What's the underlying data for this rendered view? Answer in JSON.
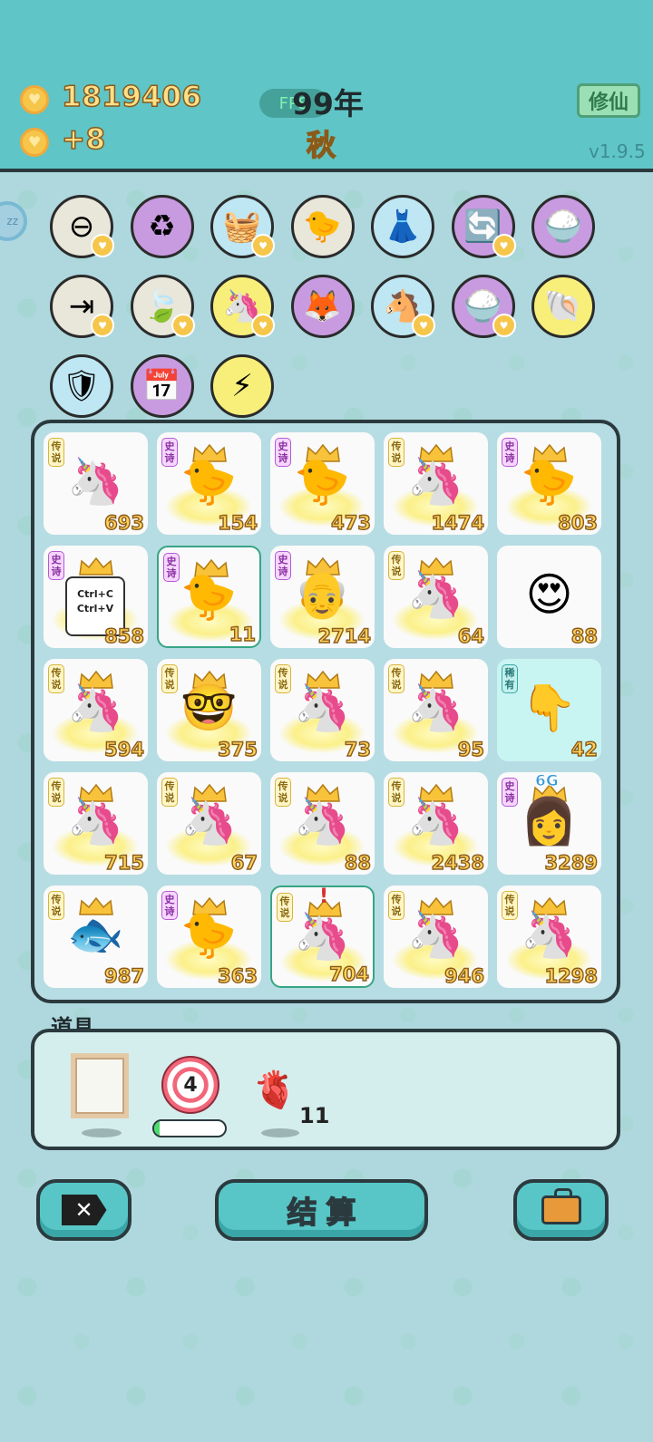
{
  "header": {
    "coins": "1819406",
    "income": "+8",
    "year": "99年",
    "fps": "FPS",
    "season": "秋",
    "xiuxian_label": "修仙",
    "version": "v1.9.5"
  },
  "relics": [
    {
      "name": "no-entry-icon",
      "glyph": "⊖",
      "color": "#e9e6da",
      "badge": true
    },
    {
      "name": "recycle-icon",
      "glyph": "♻",
      "color": "#c89be0",
      "badge": false
    },
    {
      "name": "fruit-basket-icon",
      "glyph": "🧺",
      "color": "#bfe6f3",
      "badge": true
    },
    {
      "name": "chick-egg-icon",
      "glyph": "🐤",
      "color": "#e9e6da",
      "badge": false
    },
    {
      "name": "skirt-icon",
      "glyph": "👗",
      "color": "#bfe6f3",
      "badge": false
    },
    {
      "name": "refresh-icon",
      "glyph": "🔄",
      "color": "#c89be0",
      "badge": true
    },
    {
      "name": "rice-bowl-icon",
      "glyph": "🍚",
      "color": "#c89be0",
      "badge": false
    },
    {
      "name": "skip-icon",
      "glyph": "⇥",
      "color": "#e9e6da",
      "badge": true
    },
    {
      "name": "leaf-icon",
      "glyph": "🍃",
      "color": "#e9e6da",
      "badge": true
    },
    {
      "name": "unicorn-icon",
      "glyph": "🦄",
      "color": "#f7ef7a",
      "badge": true
    },
    {
      "name": "fox-mask-icon",
      "glyph": "🦊",
      "color": "#c89be0",
      "badge": false
    },
    {
      "name": "twin-unicorn-icon",
      "glyph": "🐴",
      "color": "#bfe6f3",
      "badge": true
    },
    {
      "name": "rice-bowl-2-icon",
      "glyph": "🍚",
      "color": "#c89be0",
      "badge": true
    },
    {
      "name": "shell-icon",
      "glyph": "🐚",
      "color": "#f7ef7a",
      "badge": false
    },
    {
      "name": "shield-wrench-icon",
      "glyph": "🛡",
      "color": "#bfe6f3",
      "badge": false
    },
    {
      "name": "calendar-icon",
      "glyph": "📅",
      "color": "#c89be0",
      "badge": false
    },
    {
      "name": "lightning-icon",
      "glyph": "⚡",
      "color": "#f7ef7a",
      "badge": false
    }
  ],
  "cards": [
    {
      "tag": "传说",
      "tagType": "legend",
      "icon": "🦄",
      "num": "693",
      "crown": false,
      "glow": false
    },
    {
      "tag": "史诗",
      "tagType": "epic",
      "icon": "🐤",
      "num": "154",
      "crown": true,
      "glow": true
    },
    {
      "tag": "史诗",
      "tagType": "epic",
      "icon": "🐤",
      "num": "473",
      "crown": true,
      "glow": true
    },
    {
      "tag": "传说",
      "tagType": "legend",
      "icon": "🦄",
      "num": "1474",
      "crown": true,
      "glow": true
    },
    {
      "tag": "史诗",
      "tagType": "epic",
      "icon": "🐤",
      "num": "803",
      "crown": true,
      "glow": true
    },
    {
      "tag": "史诗",
      "tagType": "epic",
      "icon": "ctrl",
      "num": "858",
      "crown": true,
      "glow": true,
      "ctrl_text": [
        "Ctrl+C",
        "Ctrl+V"
      ]
    },
    {
      "tag": "史诗",
      "tagType": "epic",
      "icon": "🐤",
      "num": "11",
      "crown": true,
      "glow": true,
      "selected": true
    },
    {
      "tag": "史诗",
      "tagType": "epic",
      "icon": "👴",
      "num": "2714",
      "crown": true,
      "glow": true
    },
    {
      "tag": "传说",
      "tagType": "legend",
      "icon": "🦄",
      "num": "64",
      "crown": true,
      "glow": true
    },
    {
      "tag": "",
      "tagType": "",
      "icon": "😍",
      "num": "88",
      "crown": false,
      "glow": false
    },
    {
      "tag": "传说",
      "tagType": "legend",
      "icon": "🦄",
      "num": "594",
      "crown": true,
      "glow": true
    },
    {
      "tag": "传说",
      "tagType": "legend",
      "icon": "🤓",
      "num": "375",
      "crown": true,
      "glow": true
    },
    {
      "tag": "传说",
      "tagType": "legend",
      "icon": "🦄",
      "num": "73",
      "crown": true,
      "glow": true
    },
    {
      "tag": "传说",
      "tagType": "legend",
      "icon": "🦄",
      "num": "95",
      "crown": true,
      "glow": true
    },
    {
      "tag": "稀有",
      "tagType": "rarely",
      "icon": "👇",
      "num": "42",
      "crown": false,
      "glow": false,
      "cyan": true
    },
    {
      "tag": "传说",
      "tagType": "legend",
      "icon": "🦄",
      "num": "715",
      "crown": true,
      "glow": true
    },
    {
      "tag": "传说",
      "tagType": "legend",
      "icon": "🦄",
      "num": "67",
      "crown": true,
      "glow": true
    },
    {
      "tag": "传说",
      "tagType": "legend",
      "icon": "🦄",
      "num": "88",
      "crown": true,
      "glow": true
    },
    {
      "tag": "传说",
      "tagType": "legend",
      "icon": "🦄",
      "num": "2438",
      "crown": true,
      "glow": true
    },
    {
      "tag": "史诗",
      "tagType": "epic",
      "icon": "👩",
      "num": "3289",
      "crown": true,
      "glow": false,
      "sixg": "6G"
    },
    {
      "tag": "传说",
      "tagType": "legend",
      "icon": "🐟",
      "num": "987",
      "crown": true,
      "glow": false
    },
    {
      "tag": "史诗",
      "tagType": "epic",
      "icon": "🐤",
      "num": "363",
      "crown": true,
      "glow": true
    },
    {
      "tag": "传说",
      "tagType": "legend",
      "icon": "🦄",
      "num": "704",
      "crown": true,
      "glow": true,
      "selected": true,
      "alert": "!"
    },
    {
      "tag": "传说",
      "tagType": "legend",
      "icon": "🦄",
      "num": "946",
      "crown": true,
      "glow": true
    },
    {
      "tag": "传说",
      "tagType": "legend",
      "icon": "🦄",
      "num": "1298",
      "crown": true,
      "glow": true
    }
  ],
  "items": {
    "label": "道具",
    "target_count": "4",
    "target_progress": 0.08,
    "liver_count": "11"
  },
  "buttons": {
    "settle": "结算"
  }
}
